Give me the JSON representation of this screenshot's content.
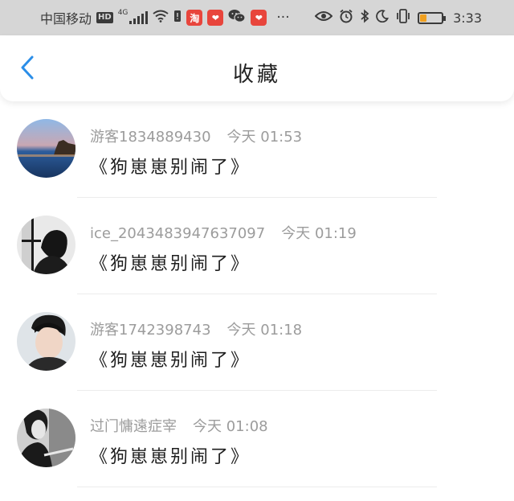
{
  "status_bar": {
    "carrier": "中国移动",
    "hd": "HD",
    "network": "4G",
    "app_icons": [
      "淘",
      "❤",
      "💬",
      "❤"
    ],
    "more": "···",
    "time": "3:33",
    "battery_level": 0.3,
    "battery_color": "#f0a020"
  },
  "header": {
    "title": "收藏",
    "back_icon_color": "#2b8ee8"
  },
  "favorites": [
    {
      "user": "游客1834889430",
      "time": "今天 01:53",
      "title": "《狗崽崽别闹了》"
    },
    {
      "user": "ice_2043483947637097",
      "time": "今天 01:19",
      "title": "《狗崽崽别闹了》"
    },
    {
      "user": "游客1742398743",
      "time": "今天 01:18",
      "title": "《狗崽崽别闹了》"
    },
    {
      "user": "过门慵遠症宰",
      "time": "今天 01:08",
      "title": "《狗崽崽别闹了》"
    }
  ]
}
